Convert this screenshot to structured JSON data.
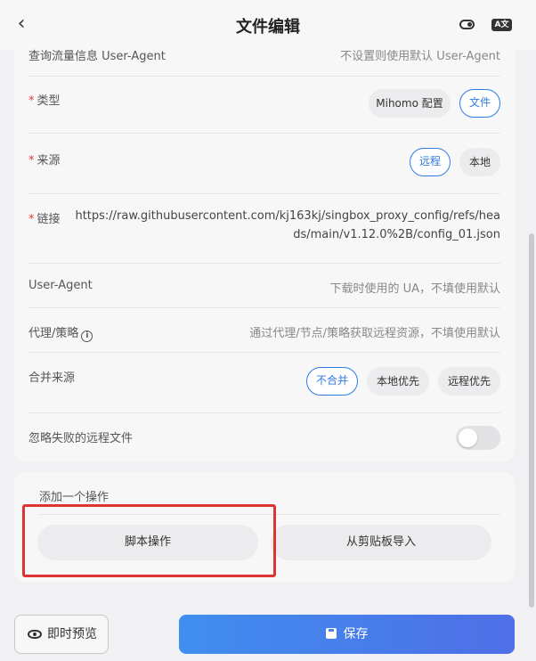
{
  "header": {
    "back_icon": "chevron-left-icon",
    "title": "文件编辑",
    "icons": [
      "toggle-icon",
      "translate-icon"
    ],
    "lang_badge": "A文"
  },
  "form": {
    "query_row": {
      "label": "查询流量信息 User-Agent",
      "value": "不设置则使用默认 User-Agent"
    },
    "type_row": {
      "required": "*",
      "label": "类型",
      "options": [
        "Mihomo 配置",
        "文件"
      ],
      "selected": "文件"
    },
    "source_row": {
      "required": "*",
      "label": "来源",
      "options": [
        "远程",
        "本地"
      ],
      "selected": "远程"
    },
    "link_row": {
      "required": "*",
      "label": "链接",
      "value": "https://raw.githubusercontent.com/kj163kj/singbox_proxy_config/refs/heads/main/v1.12.0%2B/config_01.json"
    },
    "ua_row": {
      "label": "User-Agent",
      "placeholder": "下载时使用的 UA，不填使用默认"
    },
    "proxy_row": {
      "label": "代理/策略",
      "info_icon": "info-icon",
      "info_glyph": "i",
      "placeholder": "通过代理/节点/策略获取远程资源，不填使用默认"
    },
    "merge_row": {
      "label": "合并来源",
      "options": [
        "不合并",
        "本地优先",
        "远程优先"
      ],
      "selected": "不合并"
    },
    "ignore_row": {
      "label": "忽略失败的远程文件",
      "enabled": false
    }
  },
  "actions": {
    "title": "添加一个操作",
    "buttons": [
      "脚本操作",
      "从剪贴板导入"
    ]
  },
  "highlight_color": "#d33333",
  "footer": {
    "preview_label": "即时预览",
    "save_label": "保存",
    "accent": "#3f8ef0"
  }
}
